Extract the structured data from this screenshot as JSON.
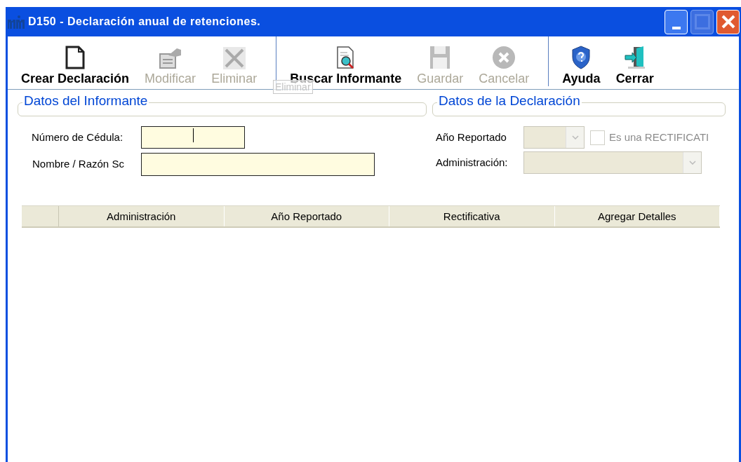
{
  "window": {
    "title": "D150 - Declaración anual de retenciones."
  },
  "toolbar_groups": [
    [
      {
        "label": "Crear Declaración",
        "kind": "new",
        "disabled": false
      },
      {
        "label": "Modificar",
        "kind": "edit",
        "disabled": true
      },
      {
        "label": "Eliminar",
        "kind": "delete",
        "disabled": true
      }
    ],
    [
      {
        "label": "Buscar Informante",
        "kind": "search",
        "disabled": false
      },
      {
        "label": "Guardar",
        "kind": "save",
        "disabled": true
      },
      {
        "label": "Cancelar",
        "kind": "cancel",
        "disabled": true
      }
    ],
    [
      {
        "label": "Ayuda",
        "kind": "help",
        "disabled": false
      },
      {
        "label": "Cerrar",
        "kind": "exit",
        "disabled": false
      }
    ]
  ],
  "tooltip": "Eliminar",
  "informante": {
    "title": "Datos del Informante",
    "cedula_label": "Número de Cédula:",
    "nombre_label": "Nombre / Razón Sc"
  },
  "declaracion": {
    "title": "Datos de la Declaración",
    "anio_label": "Año Reportado",
    "anio_disabled": true,
    "rectificativa_label": "Es una RECTIFICATI",
    "rectificativa_checked": false,
    "rectificativa_disabled": true,
    "administracion_label": "Administración:",
    "administracion_disabled": true
  },
  "table": {
    "columns": [
      "Administración",
      "Año Reportado",
      "Rectificativa",
      "Agregar Detalles"
    ]
  }
}
